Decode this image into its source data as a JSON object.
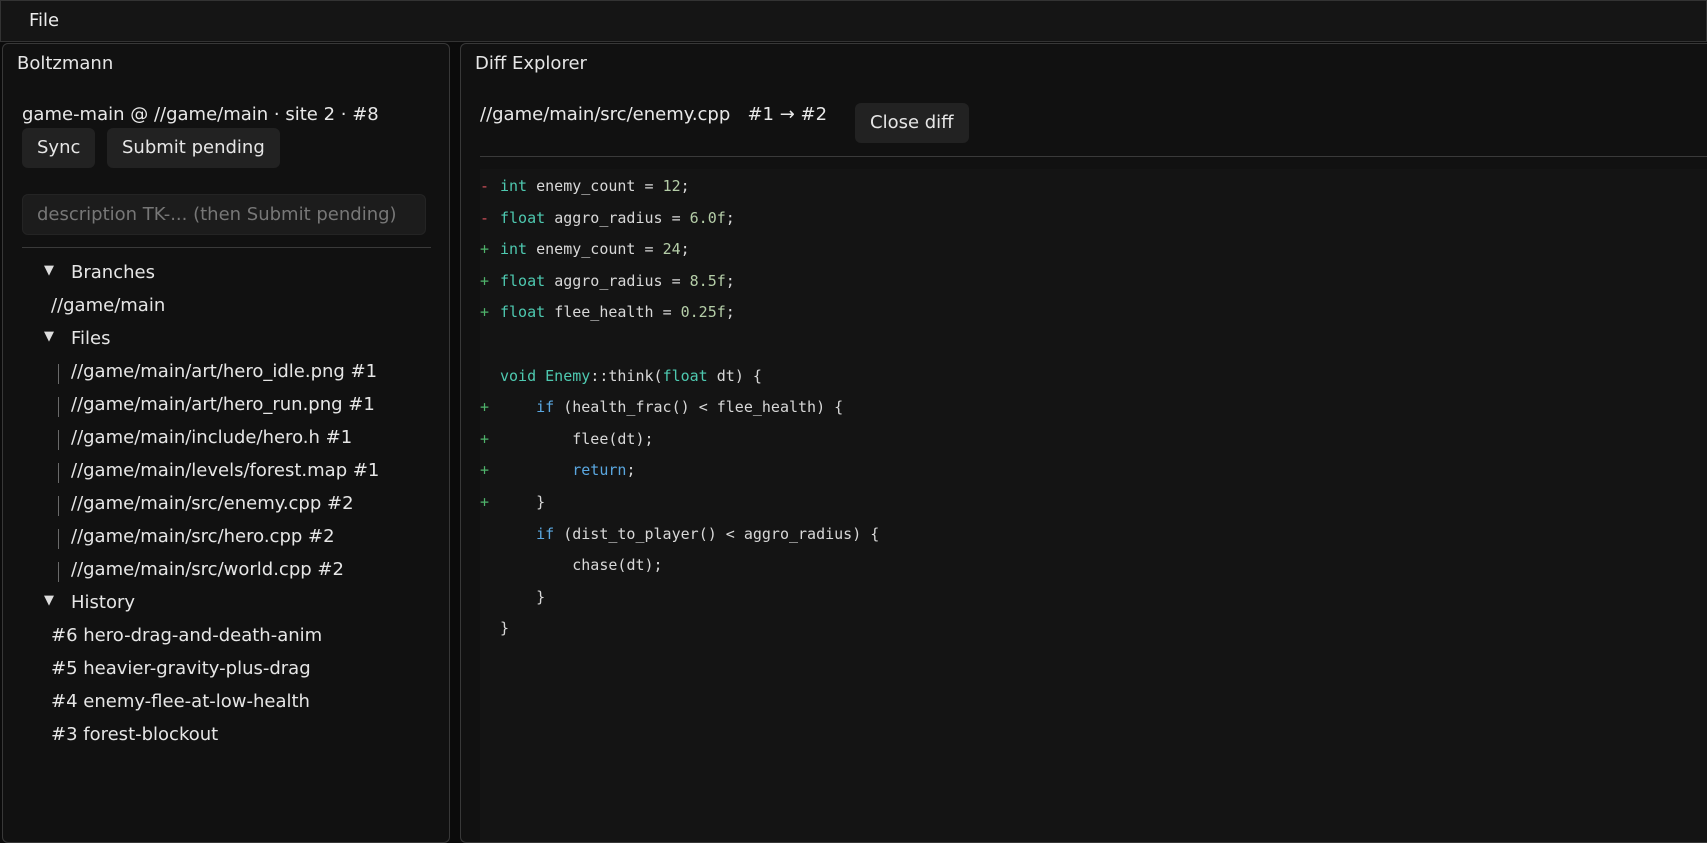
{
  "menubar": {
    "file_label": "File"
  },
  "left": {
    "title": "Boltzmann",
    "workspace": "game-main @ //game/main · site 2 · #8",
    "sync_label": "Sync",
    "submit_label": "Submit pending",
    "description_placeholder": "description TK-... (then Submit pending)",
    "branches_label": "Branches",
    "branches": [
      "//game/main"
    ],
    "files_label": "Files",
    "files": [
      "//game/main/art/hero_idle.png  #1",
      "//game/main/art/hero_run.png  #1",
      "//game/main/include/hero.h  #1",
      "//game/main/levels/forest.map  #1",
      "//game/main/src/enemy.cpp  #2",
      "//game/main/src/hero.cpp  #2",
      "//game/main/src/world.cpp  #2"
    ],
    "history_label": "History",
    "history": [
      "#6  hero-drag-and-death-anim",
      "#5  heavier-gravity-plus-drag",
      "#4  enemy-flee-at-low-health",
      "#3  forest-blockout"
    ]
  },
  "right": {
    "title": "Diff Explorer",
    "diff_header": "//game/main/src/enemy.cpp   #1 → #2",
    "close_label": "Close diff",
    "diff_lines": [
      {
        "mark": "-",
        "type": "del",
        "text": "int enemy_count = 12;"
      },
      {
        "mark": "-",
        "type": "del",
        "text": "float aggro_radius = 6.0f;"
      },
      {
        "mark": "+",
        "type": "add",
        "text": "int enemy_count = 24;"
      },
      {
        "mark": "+",
        "type": "add",
        "text": "float aggro_radius = 8.5f;"
      },
      {
        "mark": "+",
        "type": "add",
        "text": "float flee_health = 0.25f;"
      },
      {
        "mark": "",
        "type": "ctx",
        "text": ""
      },
      {
        "mark": "",
        "type": "ctx",
        "text": "void Enemy::think(float dt) {"
      },
      {
        "mark": "+",
        "type": "add",
        "text": "    if (health_frac() < flee_health) {"
      },
      {
        "mark": "+",
        "type": "add",
        "text": "        flee(dt);"
      },
      {
        "mark": "+",
        "type": "add",
        "text": "        return;"
      },
      {
        "mark": "+",
        "type": "add",
        "text": "    }"
      },
      {
        "mark": "",
        "type": "ctx",
        "text": "    if (dist_to_player() < aggro_radius) {"
      },
      {
        "mark": "",
        "type": "ctx",
        "text": "        chase(dt);"
      },
      {
        "mark": "",
        "type": "ctx",
        "text": "    }"
      },
      {
        "mark": "",
        "type": "ctx",
        "text": "}"
      }
    ]
  }
}
